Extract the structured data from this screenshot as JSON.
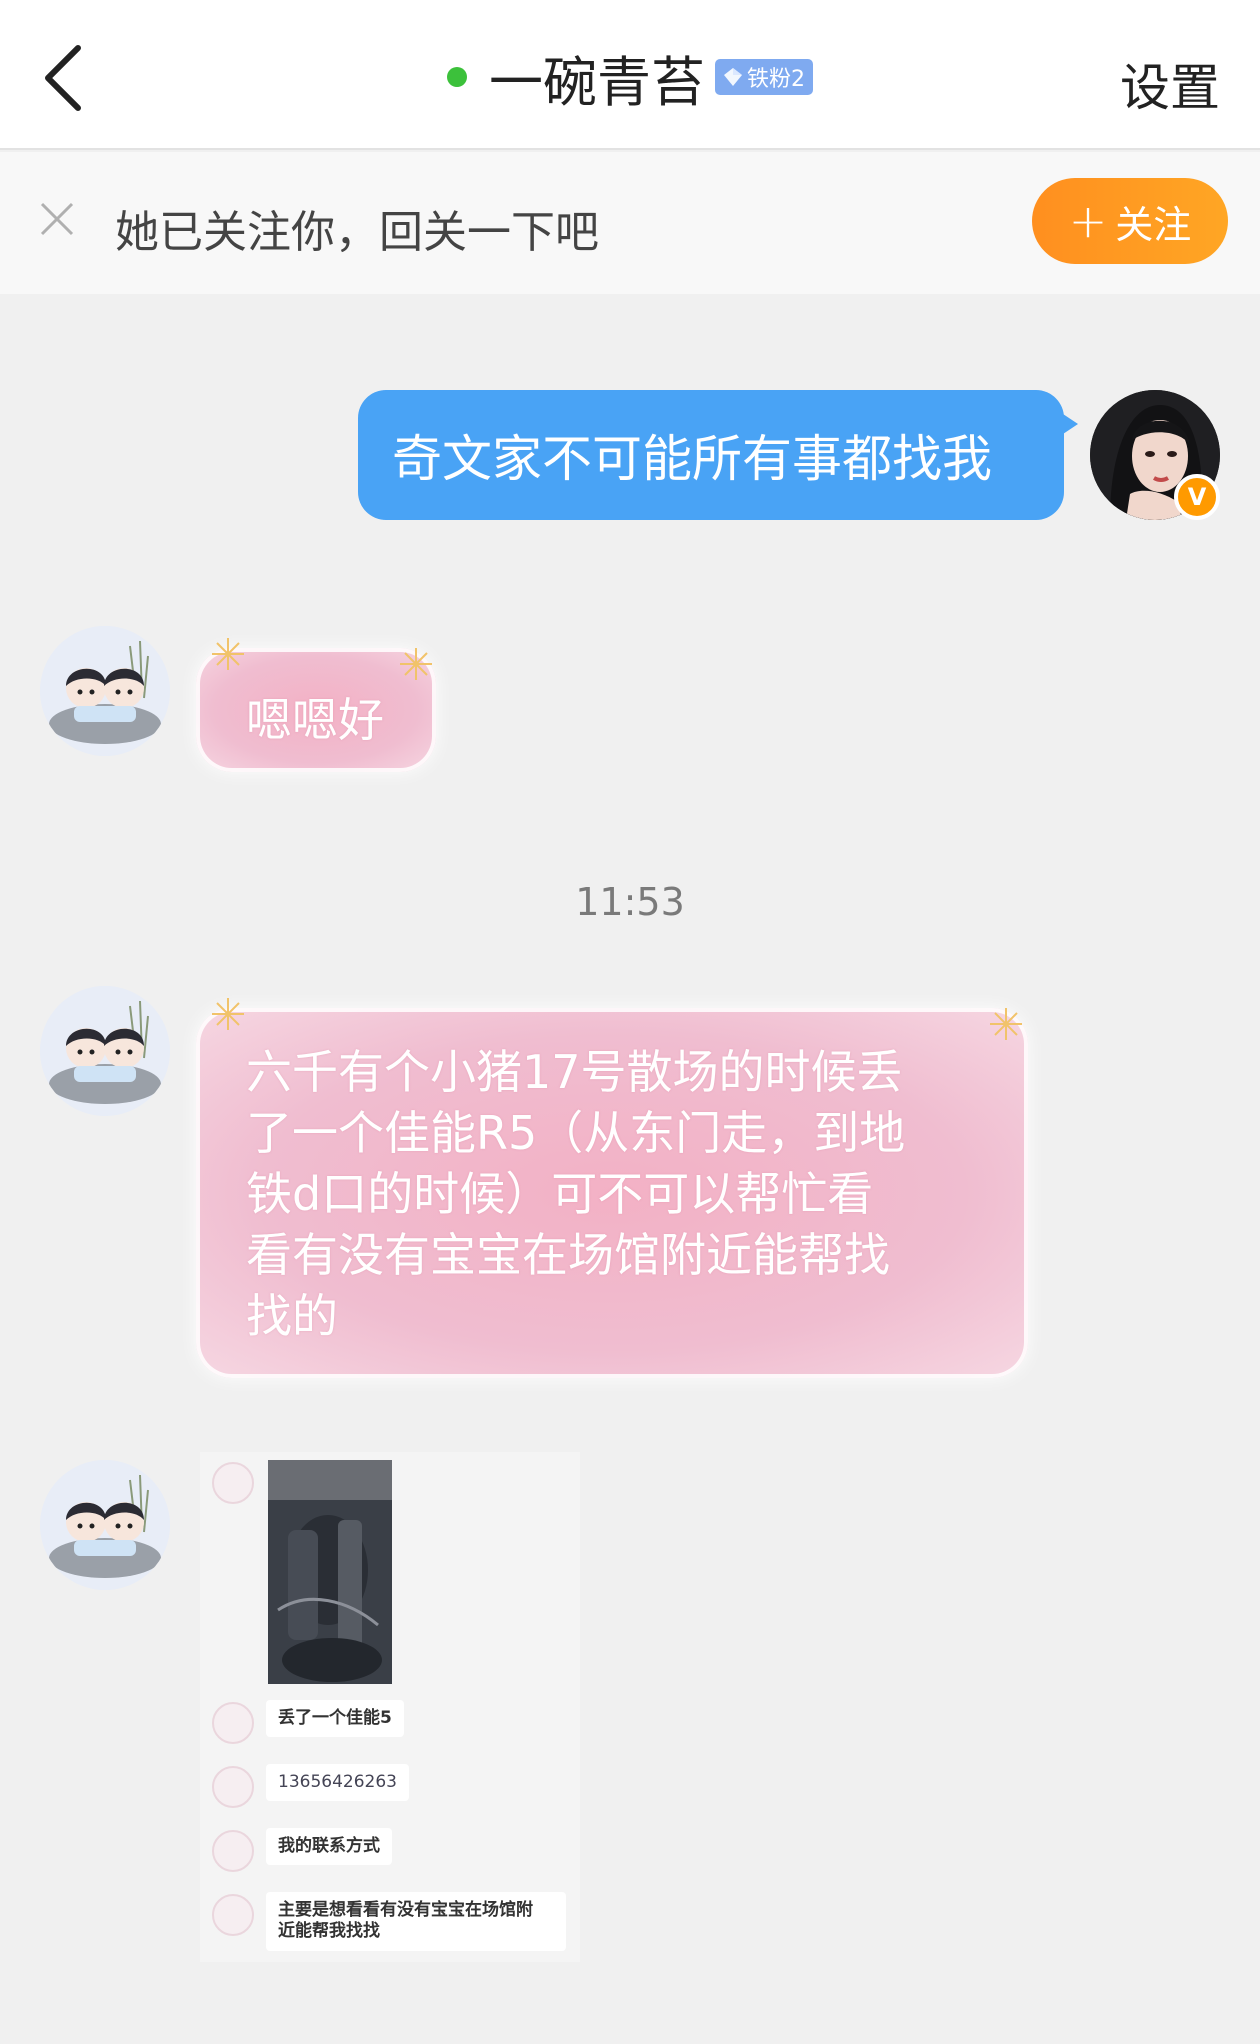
{
  "header": {
    "title": "一碗青苔",
    "badge": "铁粉2",
    "settings": "设置",
    "online": true
  },
  "follow_bar": {
    "text": "她已关注你，回关一下吧",
    "button": "关注",
    "button_plus": "+"
  },
  "messages": {
    "outgoing_1": "奇文家不可能所有事都找我",
    "incoming_1": "嗯嗯好",
    "timestamp": "11:53",
    "incoming_2_lines": [
      "六千有个小猪17号散场的时候丢",
      "了一个佳能R5（从东门走，到地",
      "铁d口的时候）可不可以帮忙看",
      "看有没有宝宝在场馆附近能帮找",
      "找的"
    ]
  },
  "screenshot": {
    "line_1": "丢了一个佳能5",
    "line_2": "13656426263",
    "line_3": "我的联系方式",
    "line_4a": "主要是想看看有没有宝宝在场馆附",
    "line_4b": "近能帮我找找"
  },
  "my_badge": "V",
  "colors": {
    "outgoing_bubble": "#49a3f5",
    "follow_button": "#ff9a1f",
    "online_dot": "#3cc13b",
    "pink_bubble": "#f0b5c8"
  }
}
